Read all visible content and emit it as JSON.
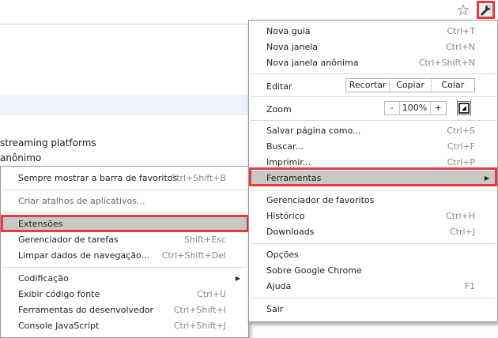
{
  "background_page": {
    "lines": [
      "streaming platforms",
      "anônimo"
    ]
  },
  "toolbar": {
    "star": "☆",
    "wrench": "wrench-icon"
  },
  "main_menu": {
    "group1": [
      {
        "label": "Nova guia",
        "shortcut": "Ctrl+T"
      },
      {
        "label": "Nova janela",
        "shortcut": "Ctrl+N"
      },
      {
        "label": "Nova janela anônima",
        "shortcut": "Ctrl+Shift+N"
      }
    ],
    "edit": {
      "label": "Editar",
      "cut": "Recortar",
      "copy": "Copiar",
      "paste": "Colar"
    },
    "zoom": {
      "label": "Zoom",
      "minus": "-",
      "value": "100%",
      "plus": "+"
    },
    "group3": [
      {
        "label": "Salvar página como...",
        "shortcut": "Ctrl+S"
      },
      {
        "label": "Buscar...",
        "shortcut": "Ctrl+F"
      },
      {
        "label": "Imprimir...",
        "shortcut": "Ctrl+P"
      }
    ],
    "tools": {
      "label": "Ferramentas",
      "arrow": "▶"
    },
    "group4": [
      {
        "label": "Gerenciador de favoritos",
        "shortcut": ""
      },
      {
        "label": "Histórico",
        "shortcut": "Ctrl+H"
      },
      {
        "label": "Downloads",
        "shortcut": "Ctrl+J"
      }
    ],
    "group5": [
      {
        "label": "Opções",
        "shortcut": ""
      },
      {
        "label": "Sobre Google Chrome",
        "shortcut": ""
      },
      {
        "label": "Ajuda",
        "shortcut": "F1"
      }
    ],
    "exit": {
      "label": "Sair"
    }
  },
  "submenu": {
    "bookmarks_bar": {
      "label": "Sempre mostrar a barra de favoritos",
      "shortcut": "Ctrl+Shift+B"
    },
    "app_shortcuts": {
      "label": "Criar atalhos de aplicativos..."
    },
    "extensions": {
      "label": "Extensões"
    },
    "task_manager": {
      "label": "Gerenciador de tarefas",
      "shortcut": "Shift+Esc"
    },
    "clear_data": {
      "label": "Limpar dados de navegação...",
      "shortcut": "Ctrl+Shift+Del"
    },
    "encoding": {
      "label": "Codificação",
      "arrow": "▶"
    },
    "view_source": {
      "label": "Exibir código fonte",
      "shortcut": "Ctrl+U"
    },
    "dev_tools": {
      "label": "Ferramentas do desenvolvedor",
      "shortcut": "Ctrl+Shift+I"
    },
    "js_console": {
      "label": "Console JavaScript",
      "shortcut": "Ctrl+Shift+J"
    }
  },
  "colors": {
    "highlight_box": "#e83c3c",
    "hover": "#c8c8c8"
  }
}
